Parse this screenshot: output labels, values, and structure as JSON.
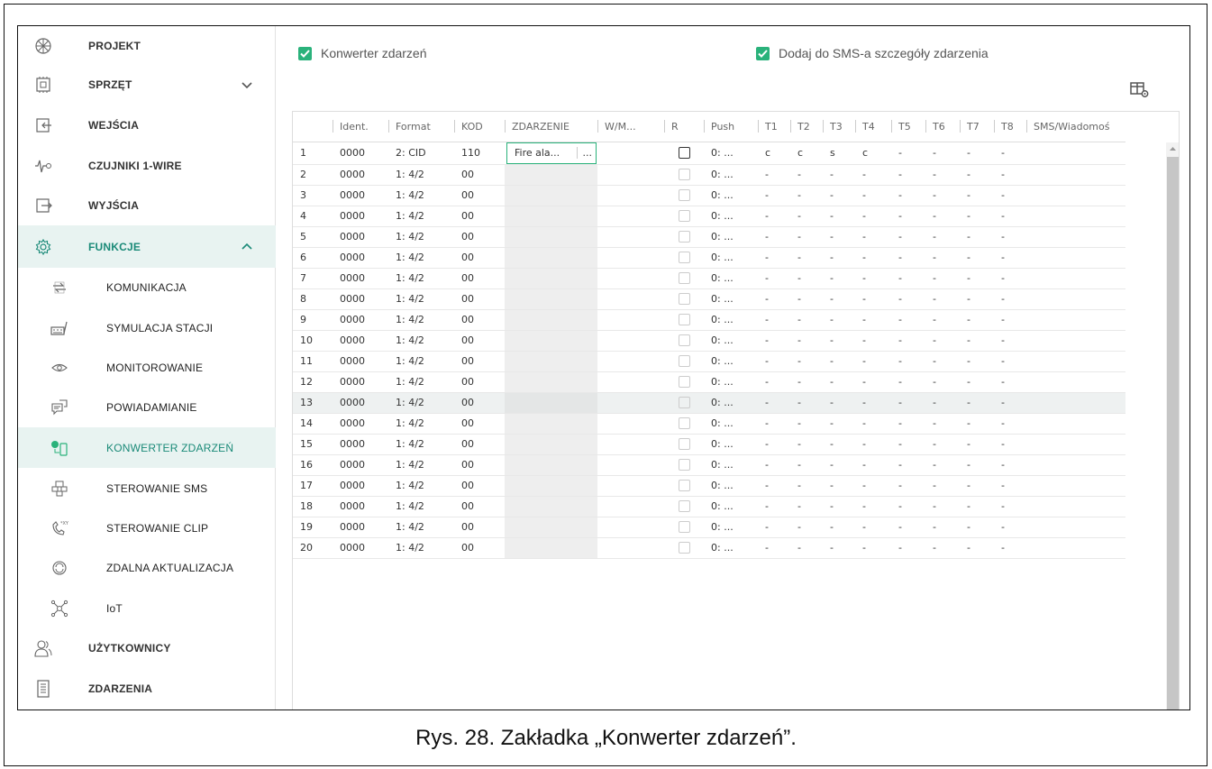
{
  "sidebar": {
    "items": [
      {
        "label": "PROJEKT",
        "icon": "projekt-icon",
        "sub": false,
        "active": false,
        "chevron": ""
      },
      {
        "label": "SPRZĘT",
        "icon": "chip-icon",
        "sub": false,
        "active": false,
        "chevron": "down"
      },
      {
        "label": "WEJŚCIA",
        "icon": "input-icon",
        "sub": false,
        "active": false,
        "chevron": ""
      },
      {
        "label": "CZUJNIKI 1-WIRE",
        "icon": "sensor-icon",
        "sub": false,
        "active": false,
        "chevron": ""
      },
      {
        "label": "WYJŚCIA",
        "icon": "output-icon",
        "sub": false,
        "active": false,
        "chevron": ""
      },
      {
        "label": "FUNKCJE",
        "icon": "gear-icon",
        "sub": false,
        "active": true,
        "chevron": "up"
      },
      {
        "label": "KOMUNIKACJA",
        "icon": "communication-icon",
        "sub": true,
        "active": false,
        "chevron": ""
      },
      {
        "label": "SYMULACJA STACJI",
        "icon": "station-icon",
        "sub": true,
        "active": false,
        "chevron": ""
      },
      {
        "label": "MONITOROWANIE",
        "icon": "eye-icon",
        "sub": true,
        "active": false,
        "chevron": ""
      },
      {
        "label": "POWIADAMIANIE",
        "icon": "notification-icon",
        "sub": true,
        "active": false,
        "chevron": ""
      },
      {
        "label": "KONWERTER ZDARZEŃ",
        "icon": "converter-icon",
        "sub": true,
        "active": true,
        "chevron": ""
      },
      {
        "label": "STEROWANIE SMS",
        "icon": "sms-control-icon",
        "sub": true,
        "active": false,
        "chevron": ""
      },
      {
        "label": "STEROWANIE CLIP",
        "icon": "clip-control-icon",
        "sub": true,
        "active": false,
        "chevron": ""
      },
      {
        "label": "ZDALNA AKTUALIZACJA",
        "icon": "update-icon",
        "sub": true,
        "active": false,
        "chevron": ""
      },
      {
        "label": "IoT",
        "icon": "iot-icon",
        "sub": true,
        "active": false,
        "chevron": ""
      },
      {
        "label": "UŻYTKOWNICY",
        "icon": "users-icon",
        "sub": false,
        "active": false,
        "chevron": ""
      },
      {
        "label": "ZDARZENIA",
        "icon": "events-icon",
        "sub": false,
        "active": false,
        "chevron": ""
      }
    ]
  },
  "options": {
    "converter_label": "Konwerter zdarzeń",
    "converter_checked": true,
    "sms_details_label": "Dodaj do SMS-a szczegóły zdarzenia",
    "sms_details_checked": true
  },
  "table": {
    "columns": [
      "",
      "Ident.",
      "Format",
      "KOD",
      "ZDARZENIE",
      "W/M...",
      "R",
      "Push",
      "T1",
      "T2",
      "T3",
      "T4",
      "T5",
      "T6",
      "T7",
      "T8",
      "SMS/Wiadomoś"
    ],
    "rows": [
      {
        "n": "1",
        "ident": "0000",
        "format": "2: CID",
        "kod": "110",
        "event": "Fire ala...",
        "wm": "",
        "r": false,
        "push": "0: ...",
        "t": [
          "c",
          "c",
          "s",
          "c",
          "-",
          "-",
          "-",
          "-"
        ]
      },
      {
        "n": "2",
        "ident": "0000",
        "format": "1: 4/2",
        "kod": "00",
        "event": "",
        "wm": "",
        "r": false,
        "push": "0: ...",
        "t": [
          "-",
          "-",
          "-",
          "-",
          "-",
          "-",
          "-",
          "-"
        ]
      },
      {
        "n": "3",
        "ident": "0000",
        "format": "1: 4/2",
        "kod": "00",
        "event": "",
        "wm": "",
        "r": false,
        "push": "0: ...",
        "t": [
          "-",
          "-",
          "-",
          "-",
          "-",
          "-",
          "-",
          "-"
        ]
      },
      {
        "n": "4",
        "ident": "0000",
        "format": "1: 4/2",
        "kod": "00",
        "event": "",
        "wm": "",
        "r": false,
        "push": "0: ...",
        "t": [
          "-",
          "-",
          "-",
          "-",
          "-",
          "-",
          "-",
          "-"
        ]
      },
      {
        "n": "5",
        "ident": "0000",
        "format": "1: 4/2",
        "kod": "00",
        "event": "",
        "wm": "",
        "r": false,
        "push": "0: ...",
        "t": [
          "-",
          "-",
          "-",
          "-",
          "-",
          "-",
          "-",
          "-"
        ]
      },
      {
        "n": "6",
        "ident": "0000",
        "format": "1: 4/2",
        "kod": "00",
        "event": "",
        "wm": "",
        "r": false,
        "push": "0: ...",
        "t": [
          "-",
          "-",
          "-",
          "-",
          "-",
          "-",
          "-",
          "-"
        ]
      },
      {
        "n": "7",
        "ident": "0000",
        "format": "1: 4/2",
        "kod": "00",
        "event": "",
        "wm": "",
        "r": false,
        "push": "0: ...",
        "t": [
          "-",
          "-",
          "-",
          "-",
          "-",
          "-",
          "-",
          "-"
        ]
      },
      {
        "n": "8",
        "ident": "0000",
        "format": "1: 4/2",
        "kod": "00",
        "event": "",
        "wm": "",
        "r": false,
        "push": "0: ...",
        "t": [
          "-",
          "-",
          "-",
          "-",
          "-",
          "-",
          "-",
          "-"
        ]
      },
      {
        "n": "9",
        "ident": "0000",
        "format": "1: 4/2",
        "kod": "00",
        "event": "",
        "wm": "",
        "r": false,
        "push": "0: ...",
        "t": [
          "-",
          "-",
          "-",
          "-",
          "-",
          "-",
          "-",
          "-"
        ]
      },
      {
        "n": "10",
        "ident": "0000",
        "format": "1: 4/2",
        "kod": "00",
        "event": "",
        "wm": "",
        "r": false,
        "push": "0: ...",
        "t": [
          "-",
          "-",
          "-",
          "-",
          "-",
          "-",
          "-",
          "-"
        ]
      },
      {
        "n": "11",
        "ident": "0000",
        "format": "1: 4/2",
        "kod": "00",
        "event": "",
        "wm": "",
        "r": false,
        "push": "0: ...",
        "t": [
          "-",
          "-",
          "-",
          "-",
          "-",
          "-",
          "-",
          "-"
        ]
      },
      {
        "n": "12",
        "ident": "0000",
        "format": "1: 4/2",
        "kod": "00",
        "event": "",
        "wm": "",
        "r": false,
        "push": "0: ...",
        "t": [
          "-",
          "-",
          "-",
          "-",
          "-",
          "-",
          "-",
          "-"
        ]
      },
      {
        "n": "13",
        "ident": "0000",
        "format": "1: 4/2",
        "kod": "00",
        "event": "",
        "wm": "",
        "r": false,
        "push": "0: ...",
        "t": [
          "-",
          "-",
          "-",
          "-",
          "-",
          "-",
          "-",
          "-"
        ]
      },
      {
        "n": "14",
        "ident": "0000",
        "format": "1: 4/2",
        "kod": "00",
        "event": "",
        "wm": "",
        "r": false,
        "push": "0: ...",
        "t": [
          "-",
          "-",
          "-",
          "-",
          "-",
          "-",
          "-",
          "-"
        ]
      },
      {
        "n": "15",
        "ident": "0000",
        "format": "1: 4/2",
        "kod": "00",
        "event": "",
        "wm": "",
        "r": false,
        "push": "0: ...",
        "t": [
          "-",
          "-",
          "-",
          "-",
          "-",
          "-",
          "-",
          "-"
        ]
      },
      {
        "n": "16",
        "ident": "0000",
        "format": "1: 4/2",
        "kod": "00",
        "event": "",
        "wm": "",
        "r": false,
        "push": "0: ...",
        "t": [
          "-",
          "-",
          "-",
          "-",
          "-",
          "-",
          "-",
          "-"
        ]
      },
      {
        "n": "17",
        "ident": "0000",
        "format": "1: 4/2",
        "kod": "00",
        "event": "",
        "wm": "",
        "r": false,
        "push": "0: ...",
        "t": [
          "-",
          "-",
          "-",
          "-",
          "-",
          "-",
          "-",
          "-"
        ]
      },
      {
        "n": "18",
        "ident": "0000",
        "format": "1: 4/2",
        "kod": "00",
        "event": "",
        "wm": "",
        "r": false,
        "push": "0: ...",
        "t": [
          "-",
          "-",
          "-",
          "-",
          "-",
          "-",
          "-",
          "-"
        ]
      },
      {
        "n": "19",
        "ident": "0000",
        "format": "1: 4/2",
        "kod": "00",
        "event": "",
        "wm": "",
        "r": false,
        "push": "0: ...",
        "t": [
          "-",
          "-",
          "-",
          "-",
          "-",
          "-",
          "-",
          "-"
        ]
      },
      {
        "n": "20",
        "ident": "0000",
        "format": "1: 4/2",
        "kod": "00",
        "event": "",
        "wm": "",
        "r": false,
        "push": "0: ...",
        "t": [
          "-",
          "-",
          "-",
          "-",
          "-",
          "-",
          "-",
          "-"
        ]
      }
    ],
    "selected_row": "13",
    "event_edit_button": "..."
  },
  "caption": "Rys. 28. Zakładka „Konwerter zdarzeń”.",
  "colors": {
    "accent": "#2ab27b",
    "active_bg": "#e8f3f1",
    "active_text": "#1a8a78"
  }
}
